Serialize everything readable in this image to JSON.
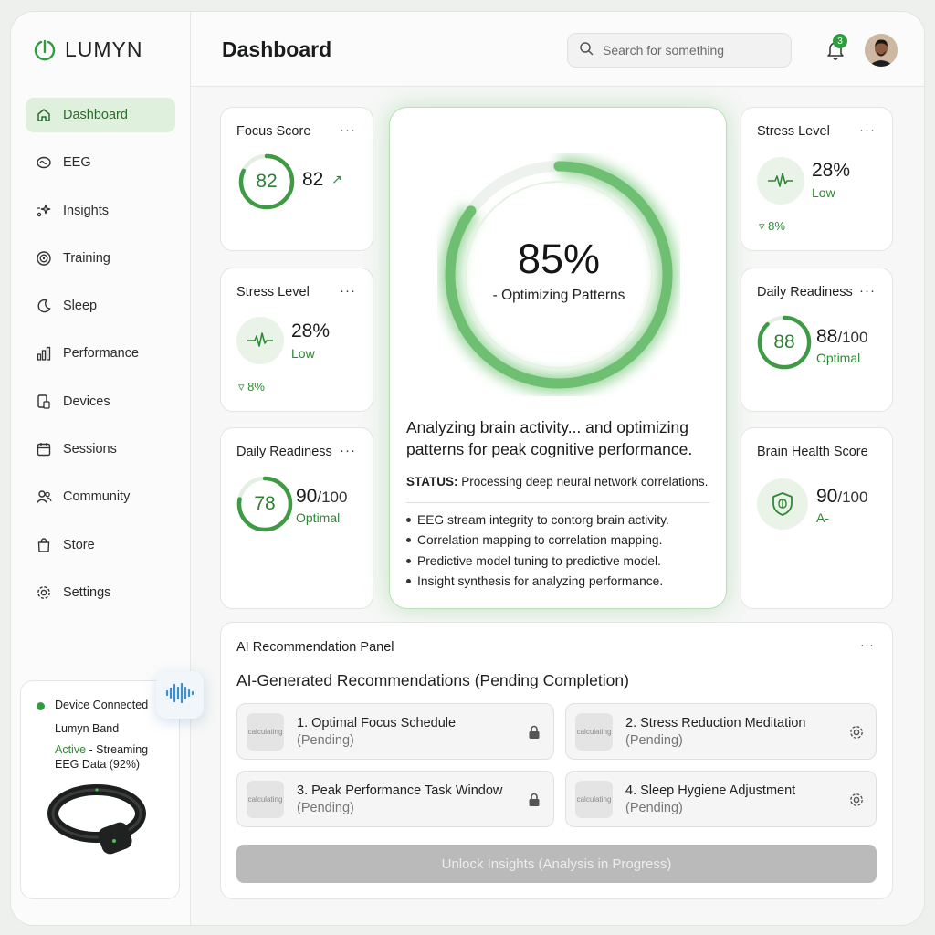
{
  "brand": {
    "name": "LUMYN",
    "accent": "#2f9c3e"
  },
  "nav": {
    "items": [
      {
        "label": "Dashboard",
        "icon": "home-icon",
        "active": true
      },
      {
        "label": "EEG",
        "icon": "brain-icon"
      },
      {
        "label": "Insights",
        "icon": "sparkle-icon"
      },
      {
        "label": "Training",
        "icon": "target-icon"
      },
      {
        "label": "Sleep",
        "icon": "moon-icon"
      },
      {
        "label": "Performance",
        "icon": "bar-chart-icon"
      },
      {
        "label": "Devices",
        "icon": "device-icon"
      },
      {
        "label": "Sessions",
        "icon": "calendar-icon"
      },
      {
        "label": "Community",
        "icon": "users-icon"
      },
      {
        "label": "Store",
        "icon": "bag-icon"
      },
      {
        "label": "Settings",
        "icon": "gear-icon"
      }
    ]
  },
  "device": {
    "title": "Device Connected",
    "name": "Lumyn Band",
    "status_active": "Active",
    "status_rest": " - Streaming EEG Data (92%)"
  },
  "header": {
    "title": "Dashboard",
    "search_placeholder": "Search for something",
    "notifications": "3"
  },
  "cards": {
    "focus": {
      "title": "Focus Score",
      "ring": "82",
      "value": "82",
      "trend": "↗",
      "progress": 0.82
    },
    "stress_left": {
      "title": "Stress Level",
      "value": "28%",
      "label": "Low",
      "trend": "8%"
    },
    "readiness_left": {
      "title": "Daily Readiness",
      "ring": "78",
      "value": "90",
      "of": "/100",
      "label": "Optimal",
      "progress": 0.78
    },
    "stress_right": {
      "title": "Stress Level",
      "value": "28%",
      "label": "Low",
      "trend": "8%"
    },
    "readiness_right": {
      "title": "Daily Readiness",
      "ring": "88",
      "value": "88",
      "of": "/100",
      "label": "Optimal",
      "progress": 0.88
    },
    "brain_health": {
      "title": "Brain Health Score",
      "value": "90",
      "of": "/100",
      "label": "A-"
    },
    "menu": "···"
  },
  "center": {
    "percent": "85%",
    "progress": 0.85,
    "subtitle": "- Optimizing Patterns",
    "heading": "Analyzing brain activity... and optimizing patterns for peak cognitive performance.",
    "status_label": "STATUS:",
    "status_text": " Processing deep neural network correlations.",
    "bullets": [
      "EEG stream integrity to contorg brain activity.",
      "Correlation mapping to correlation mapping.",
      "Predictive model tuning to predictive model.",
      "Insight synthesis for analyzing performance."
    ]
  },
  "recommendations": {
    "panel_title": "AI Recommendation Panel",
    "subtitle": "AI-Generated Recommendations (Pending Completion)",
    "thumb_label": "calculating",
    "items": [
      {
        "name": "1. Optimal Focus Schedule",
        "state": "(Pending)",
        "icon": "lock-icon"
      },
      {
        "name": "2. Stress Reduction Meditation",
        "state": "(Pending)",
        "icon": "gear-icon"
      },
      {
        "name": "3. Peak Performance Task Window",
        "state": "(Pending)",
        "icon": "lock-icon"
      },
      {
        "name": "4. Sleep Hygiene Adjustment",
        "state": "(Pending)",
        "icon": "gear-icon"
      }
    ],
    "unlock_label": "Unlock Insights (Analysis in Progress)"
  }
}
